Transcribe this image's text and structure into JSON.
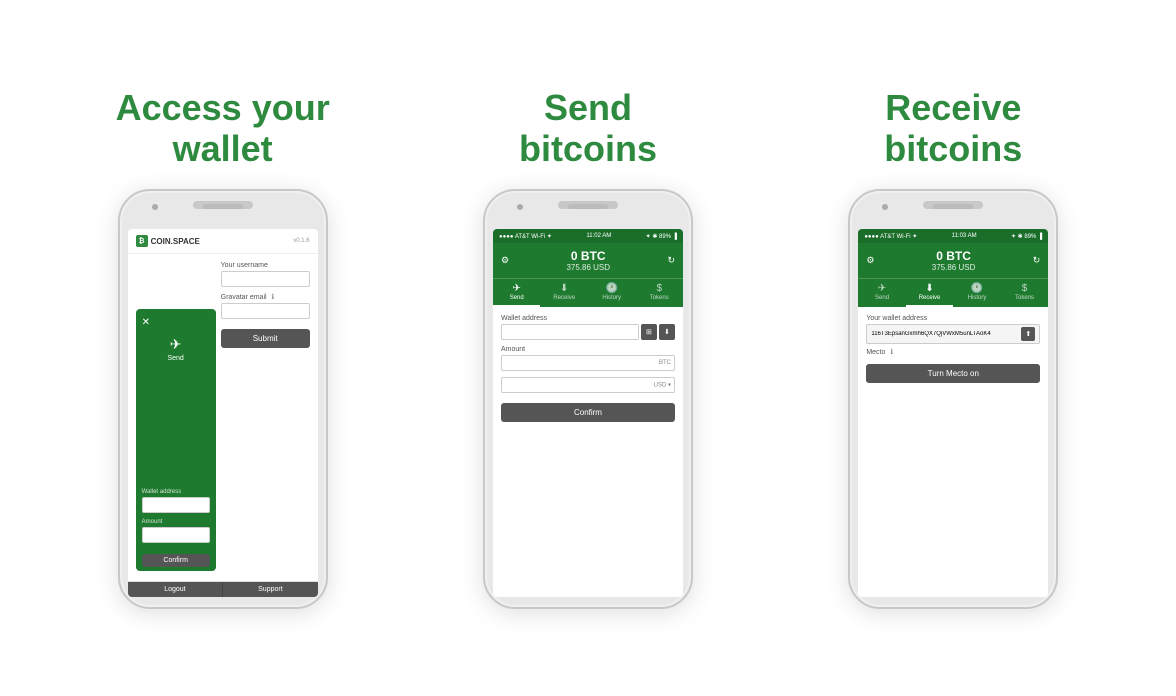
{
  "sections": [
    {
      "id": "wallet",
      "title_line1": "Access your",
      "title_line2": "wallet"
    },
    {
      "id": "send",
      "title_line1": "Send",
      "title_line2": "bitcoins"
    },
    {
      "id": "receive",
      "title_line1": "Receive",
      "title_line2": "bitcoins"
    }
  ],
  "phone1": {
    "version": "v0.1.6",
    "username_label": "Your username",
    "gravatar_label": "Gravatar email",
    "submit_label": "Submit",
    "logout_label": "Logout",
    "support_label": "Support",
    "send_label": "Send"
  },
  "phone2": {
    "status_carrier": "●●●● AT&T Wi-Fi ✦",
    "status_time": "11:02 AM",
    "status_right": "✦ ✱ 89% ▐",
    "balance_btc": "0",
    "balance_unit": "BTC",
    "balance_usd": "375.86 USD",
    "wallet_address_label": "Wallet address",
    "amount_label": "Amount",
    "btc_label": "BTC",
    "usd_label": "USD ▾",
    "confirm_label": "Confirm",
    "tabs": [
      "Send",
      "Receive",
      "History",
      "Tokens"
    ]
  },
  "phone3": {
    "status_carrier": "●●●● AT&T Wi-Fi ✦",
    "status_time": "11:03 AM",
    "status_right": "✦ ✱ 89% ▐",
    "balance_btc": "0",
    "balance_unit": "BTC",
    "balance_usd": "375.86 USD",
    "wallet_address_label": "Your wallet address",
    "wallet_address_value": "116T3EpsanGxmh6QX7QjVWxM5unLTAoK4",
    "mecto_label": "Mecto",
    "turn_mecto_label": "Turn Mecto on",
    "tabs": [
      "Send",
      "Receive",
      "History",
      "Tokens"
    ]
  }
}
